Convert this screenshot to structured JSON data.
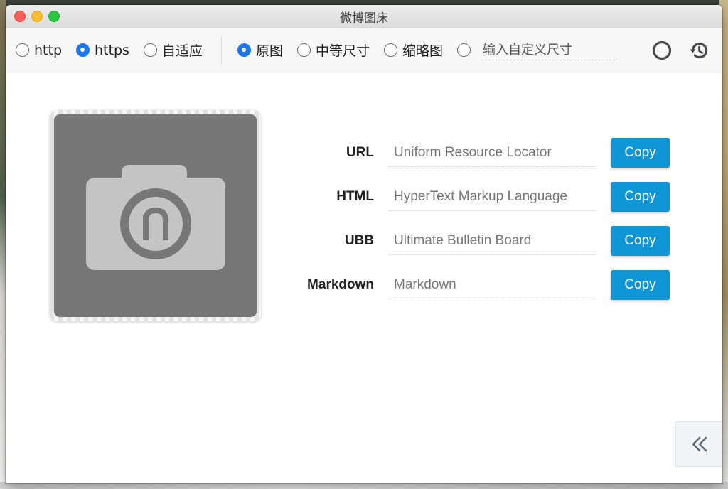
{
  "window": {
    "title": "微博图床"
  },
  "toolbar": {
    "protocol_options": [
      {
        "label": "http",
        "checked": false
      },
      {
        "label": "https",
        "checked": true
      },
      {
        "label": "自适应",
        "checked": false
      }
    ],
    "size_options": [
      {
        "label": "原图",
        "checked": true
      },
      {
        "label": "中等尺寸",
        "checked": false
      },
      {
        "label": "缩略图",
        "checked": false
      }
    ],
    "custom_size_placeholder": "输入自定义尺寸",
    "icons": [
      "circle-icon",
      "history-icon"
    ]
  },
  "upload": {
    "icon": "camera-icon"
  },
  "links": [
    {
      "label": "URL",
      "value": "Uniform Resource Locator",
      "button": "Copy"
    },
    {
      "label": "HTML",
      "value": "HyperText Markup Language",
      "button": "Copy"
    },
    {
      "label": "UBB",
      "value": "Ultimate Bulletin Board",
      "button": "Copy"
    },
    {
      "label": "Markdown",
      "value": "Markdown",
      "button": "Copy"
    }
  ],
  "colors": {
    "accent": "#1877f2",
    "copy_button": "#0e96d6"
  }
}
